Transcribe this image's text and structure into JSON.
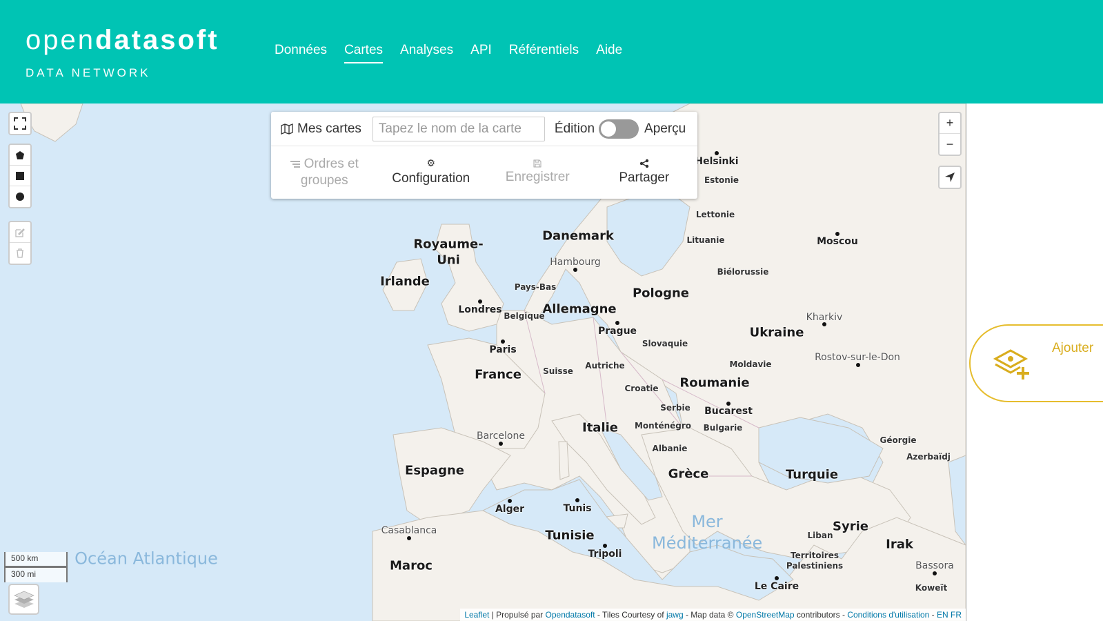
{
  "header": {
    "logo_part1": "open",
    "logo_part2": "data",
    "logo_part3": "soft",
    "logo_sub": "DATA NETWORK",
    "nav": [
      {
        "label": "Données",
        "active": false
      },
      {
        "label": "Cartes",
        "active": true
      },
      {
        "label": "Analyses",
        "active": false
      },
      {
        "label": "API",
        "active": false
      },
      {
        "label": "Référentiels",
        "active": false
      },
      {
        "label": "Aide",
        "active": false
      }
    ]
  },
  "toolbar": {
    "mes_cartes": "Mes cartes",
    "map_name_placeholder": "Tapez le nom de la carte",
    "edition": "Édition",
    "apercu": "Aperçu",
    "actions": {
      "ordres_line1": "Ordres et",
      "ordres_line2": "groupes",
      "configuration": "Configuration",
      "enregistrer": "Enregistrer",
      "partager": "Partager"
    }
  },
  "map": {
    "countries": [
      "Danemark",
      "Royaume-Uni",
      "Irlande",
      "Pologne",
      "Allemagne",
      "Ukraine",
      "France",
      "Roumanie",
      "Italie",
      "Espagne",
      "Grèce",
      "Turquie",
      "Tunisie",
      "Maroc",
      "Syrie",
      "Irak"
    ],
    "small_countries": [
      "Estonie",
      "Lettonie",
      "Lituanie",
      "Biélorussie",
      "Pays-Bas",
      "Belgique",
      "Slovaquie",
      "Autriche",
      "Suisse",
      "Moldavie",
      "Croatie",
      "Serbie",
      "Monténégro",
      "Bulgarie",
      "Albanie",
      "Géorgie",
      "Azerbaïdj",
      "Liban",
      "Territoires",
      "Palestiniens",
      "Koweït"
    ],
    "cities": [
      "Helsinki",
      "Moscou",
      "Hambourg",
      "Londres",
      "Paris",
      "Prague",
      "Kharkiv",
      "Rostov-sur-le-Don",
      "Bucarest",
      "Barcelone",
      "Alger",
      "Tunis",
      "Tripoli",
      "Casablanca",
      "Le Caire",
      "Bassora"
    ],
    "seas": [
      "Océan Atlantique",
      "Mer Méditerranée"
    ],
    "scale_km": "500 km",
    "scale_mi": "300 mi",
    "attribution": {
      "leaflet": "Leaflet",
      "propulse": " | Propulsé par ",
      "ods": "Opendatasoft",
      "tiles": " - Tiles Courtesy of ",
      "jawg": "jawg",
      "mapdata": " - Map data © ",
      "osm": "OpenStreetMap",
      "contrib": " contributors - ",
      "conditions": "Conditions d'utilisation",
      "sep": " - ",
      "en": "EN",
      "fr": "FR"
    }
  },
  "right_panel": {
    "add_label": "Ajouter"
  },
  "colors": {
    "header_bg": "#00c4b4",
    "sea": "#d6e9f8",
    "land": "#f4f1ec",
    "accent_gold": "#e6bd2e"
  },
  "icons": [
    "expand-icon",
    "polygon-icon",
    "rectangle-icon",
    "circle-icon",
    "edit-icon",
    "trash-icon",
    "zoom-in-icon",
    "zoom-out-icon",
    "locate-icon",
    "map-icon",
    "list-icon",
    "gear-icon",
    "save-icon",
    "share-icon",
    "layers-icon",
    "add-layer-icon"
  ]
}
